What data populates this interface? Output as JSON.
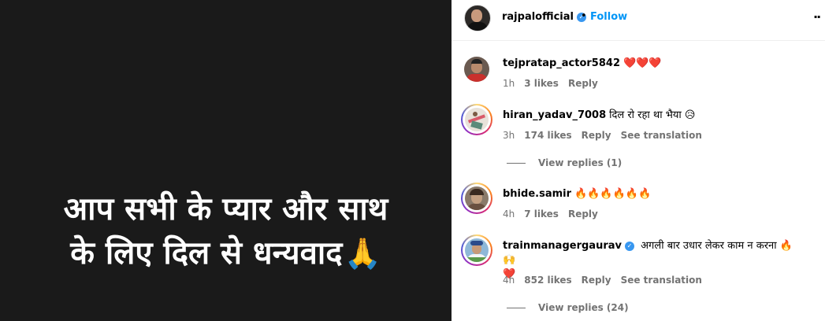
{
  "media": {
    "line1": "आप सभी के प्यार और साथ",
    "line2": "के लिए दिल से धन्यवाद",
    "emoji": "🙏"
  },
  "header": {
    "username": "rajpalofficial",
    "verified_mark": "✓",
    "separator": "•",
    "follow_label": "Follow",
    "more_label": "··"
  },
  "comments": [
    {
      "username": "tejpratap_actor5842",
      "text": "❤️❤️❤️",
      "time": "1h",
      "likes": "3 likes",
      "reply": "Reply",
      "translation": ""
    },
    {
      "username": "hiran_yadav_7008",
      "text": "दिल रो रहा था भैया 😥",
      "time": "3h",
      "likes": "174 likes",
      "reply": "Reply",
      "translation": "See translation",
      "view_replies": "View replies (1)"
    },
    {
      "username": "bhide.samir",
      "text": "🔥🔥🔥🔥🔥🔥",
      "time": "4h",
      "likes": "7 likes",
      "reply": "Reply",
      "translation": ""
    },
    {
      "username": "trainmanagergaurav",
      "verified_mark": "✓",
      "text": "अगली बार उधार लेकर काम न करना 🔥🙌",
      "text2": "❤️",
      "time": "4h",
      "likes": "852 likes",
      "reply": "Reply",
      "translation": "See translation",
      "view_replies": "View replies (24)"
    }
  ],
  "colors": {
    "media_bg": "#1a1a1a",
    "link_blue": "#0095f6",
    "verified_blue": "#3897f0",
    "meta_gray": "#737373"
  }
}
